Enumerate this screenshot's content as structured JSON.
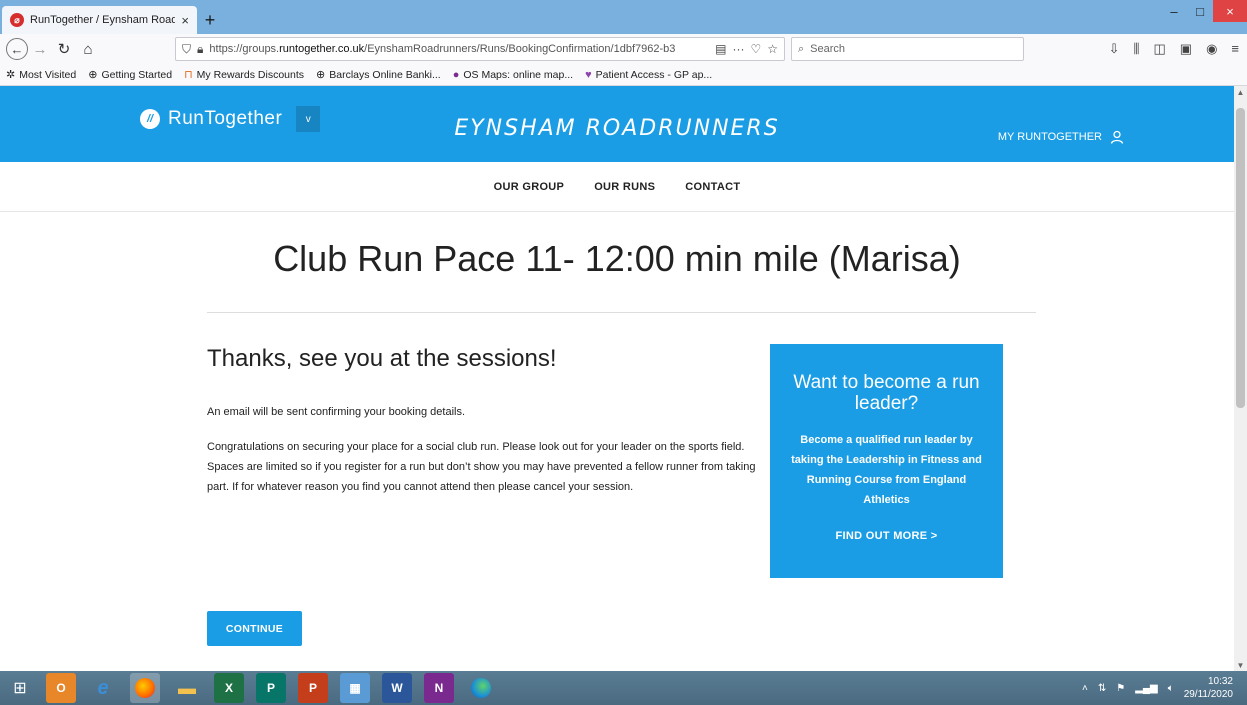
{
  "browser": {
    "tab_title": "RunTogether / Eynsham Roadr",
    "tab_close": "×",
    "new_tab": "+",
    "url_prefix": "https://groups.",
    "url_domain": "runtogether.co.uk",
    "url_path": "/EynshamRoadrunners/Runs/BookingConfirmation/1dbf7962-b3",
    "url_more": "···",
    "search_placeholder": "Search",
    "window_min": "–",
    "window_max": "□",
    "window_close": "×"
  },
  "bookmarks": [
    {
      "label": "Most Visited",
      "icon": "✲"
    },
    {
      "label": "Getting Started",
      "icon": "⊕"
    },
    {
      "label": "My Rewards Discounts",
      "icon": "⊓"
    },
    {
      "label": "Barclays Online Banki...",
      "icon": "⊕"
    },
    {
      "label": "OS Maps: online map...",
      "icon": "●"
    },
    {
      "label": "Patient Access - GP ap...",
      "icon": "♥"
    }
  ],
  "header": {
    "brand": "RunTogether",
    "brand_logo": "//",
    "dropdown_caret": "v",
    "club_name": "EYNSHAM ROADRUNNERS",
    "my_account": "MY RUNTOGETHER"
  },
  "nav": {
    "our_group": "OUR GROUP",
    "our_runs": "OUR RUNS",
    "contact": "CONTACT"
  },
  "main": {
    "title": "Club Run Pace 11- 12:00 min mile (Marisa)",
    "thanks_heading": "Thanks, see you at the sessions!",
    "email_note": "An email will be sent confirming your booking details.",
    "body": "Congratulations on securing your place for a social club run. Please look out for your leader on the sports field. Spaces are limited so if you register for a run but don’t show you may have prevented a fellow runner from taking part. If for whatever reason you find you cannot attend then please cancel your session.",
    "continue_label": "CONTINUE"
  },
  "promo": {
    "heading": "Want to become a run leader?",
    "text": "Become a qualified run leader by taking the Leadership in Fitness and Running Course from England Athletics",
    "link": "FIND OUT MORE >"
  },
  "taskbar": {
    "time": "10:32",
    "date": "29/11/2020"
  },
  "colors": {
    "brand_blue": "#1a9de4",
    "tabbar": "#7ab0dd"
  }
}
